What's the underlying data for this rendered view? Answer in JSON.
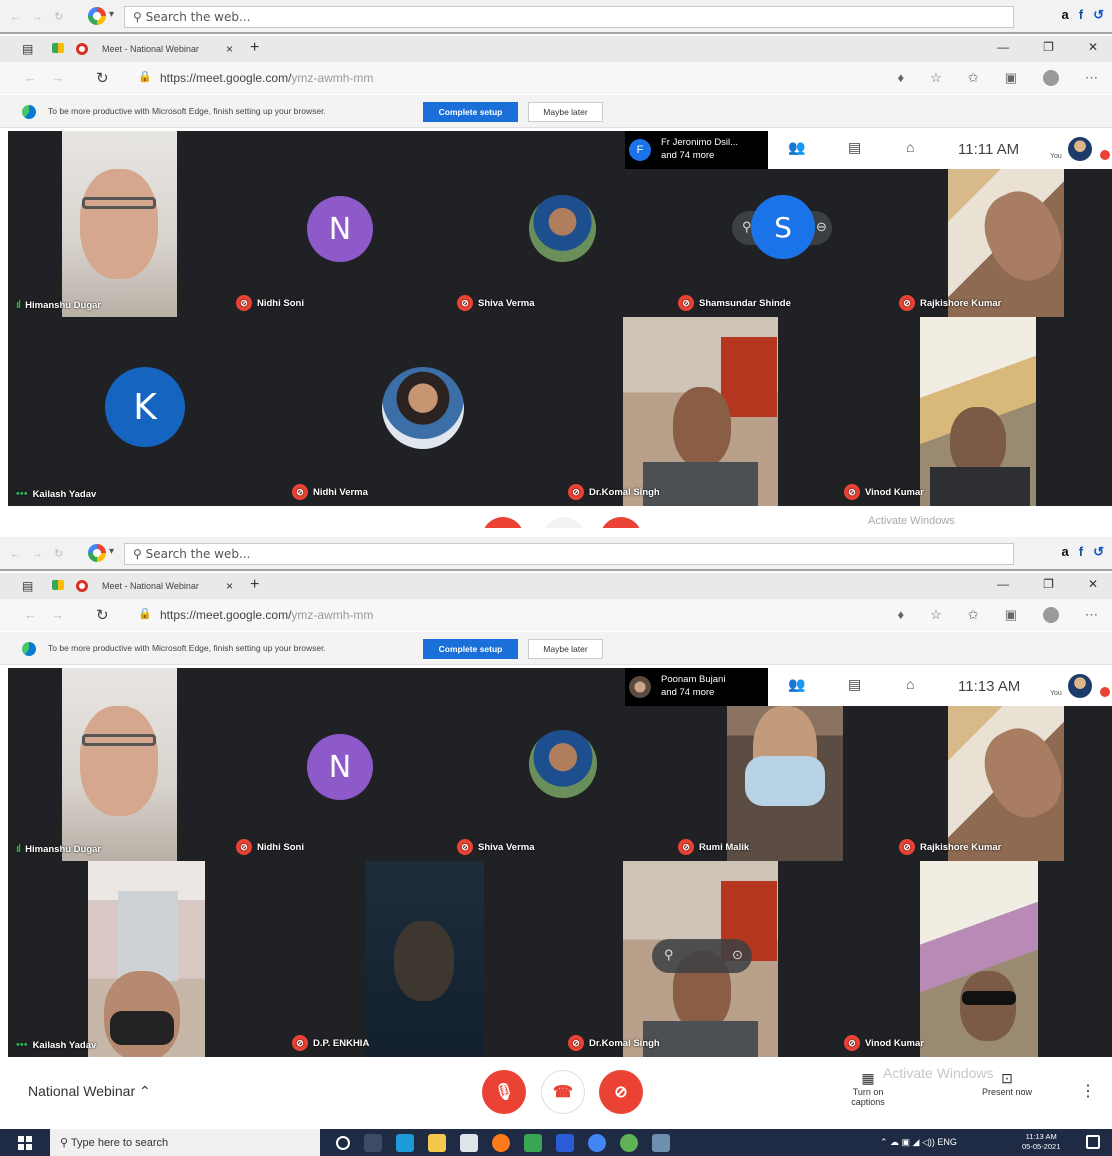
{
  "browser": {
    "search_placeholder": "Search the web...",
    "tab_title": "Meet - National Webinar",
    "url_host": "https://meet.google.com/",
    "url_path": "ymz-awmh-mm",
    "info_text": "To be more productive with Microsoft Edge, finish setting up your browser.",
    "complete_setup": "Complete setup",
    "maybe_later": "Maybe later"
  },
  "shot1": {
    "presence_line1": "Fr Jeronimo Dsil...",
    "presence_line2": "and 74 more",
    "presence_initial": "F",
    "time": "11:11 AM",
    "you": "You",
    "tiles": [
      {
        "name": "Himanshu Dugar"
      },
      {
        "name": "Nidhi Soni",
        "initial": "N"
      },
      {
        "name": "Shiva Verma"
      },
      {
        "name": "Shamsundar Shinde",
        "initial": "S"
      },
      {
        "name": "Rajkishore Kumar"
      },
      {
        "name": "Kailash Yadav",
        "initial": "K"
      },
      {
        "name": "Nidhi Verma"
      },
      {
        "name": "Dr.Komal Singh"
      },
      {
        "name": "Vinod Kumar"
      }
    ],
    "activate": "Activate Windows"
  },
  "shot2": {
    "presence_line1": "Poonam Bujani",
    "presence_line2": "and 74 more",
    "time": "11:13 AM",
    "you": "You",
    "tiles": [
      {
        "name": "Himanshu Dugar"
      },
      {
        "name": "Nidhi Soni",
        "initial": "N"
      },
      {
        "name": "Shiva Verma"
      },
      {
        "name": "Rumi Malik"
      },
      {
        "name": "Rajkishore Kumar"
      },
      {
        "name": "Kailash Yadav"
      },
      {
        "name": "D.P. ENKHIA"
      },
      {
        "name": "Dr.Komal Singh"
      },
      {
        "name": "Vinod Kumar"
      }
    ]
  },
  "controls": {
    "meeting_name": "National Webinar",
    "captions": "Turn on captions",
    "present": "Present now",
    "watermark": "Activate Windows"
  },
  "taskbar": {
    "search_placeholder": "Type here to search",
    "lang": "ENG",
    "clock_time": "11:13 AM",
    "clock_date": "05-05-2021"
  },
  "colors": {
    "meet_bg": "#202124",
    "mic_off": "#ea4335",
    "accent": "#1a73e8"
  }
}
